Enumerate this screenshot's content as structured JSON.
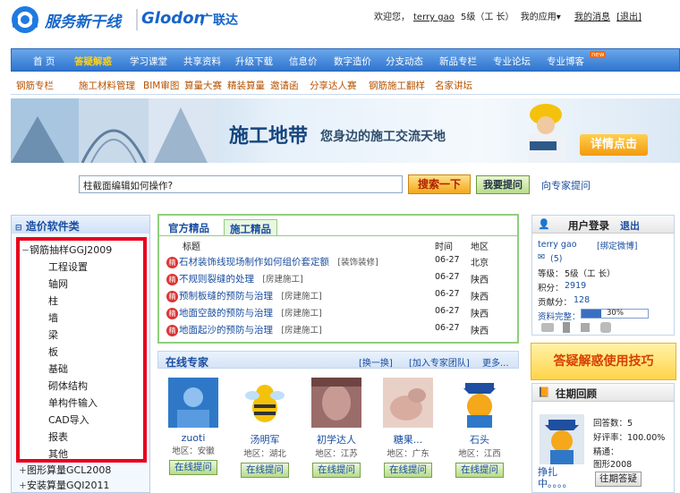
{
  "header": {
    "logo_text": "服务新干线",
    "brand": "Glodon",
    "brand_cn": "广联达",
    "welcome": "欢迎您，",
    "username": "terry gao",
    "level": "5级（工    长）",
    "my_app": "我的应用▾",
    "my_msg": "我的消息",
    "logout": "[退出]"
  },
  "nav": [
    "首 页",
    "答疑解惑",
    "学习课堂",
    "共享资料",
    "升级下载",
    "信息价",
    "数字造价",
    "分支动态",
    "新品专栏",
    "专业论坛",
    "专业博客"
  ],
  "nav_new_badge": "new",
  "subnav": [
    "钢筋专栏",
    "施工材料管理",
    "BIM审图",
    "算量大赛",
    "精装算量",
    "邀请函",
    "分享达人赛",
    "钢筋施工翻样",
    "名家讲坛"
  ],
  "banner": {
    "title": "施工地带",
    "slogan": "您身边的施工交流天地",
    "detail_btn": "详情点击"
  },
  "search": {
    "value": "柱截面编辑如何操作?",
    "search_btn": "搜索一下",
    "ask_btn": "我要提问",
    "expert_link": "向专家提问"
  },
  "tree": {
    "head": "造价软件类",
    "expanded": "钢筋抽样GGJ2009",
    "children": [
      "工程设置",
      "轴网",
      "柱",
      "墙",
      "梁",
      "板",
      "基础",
      "砌体结构",
      "单构件输入",
      "CAD导入",
      "报表",
      "其他"
    ],
    "collapsed": [
      "图形算量GCL2008",
      "安装算量GQI2011"
    ]
  },
  "notice": {
    "tabs": [
      "官方精品",
      "施工精品"
    ],
    "cols": [
      "标题",
      "时间",
      "地区"
    ],
    "rows": [
      {
        "title": "石材装饰线现场制作如何组价套定额",
        "tag": "[装饰装修]",
        "date": "06-27",
        "region": "北京"
      },
      {
        "title": "不规则裂缝的处理",
        "tag": "[房建施工]",
        "date": "06-27",
        "region": "陕西"
      },
      {
        "title": "预制板缝的预防与治理",
        "tag": "[房建施工]",
        "date": "06-27",
        "region": "陕西"
      },
      {
        "title": "地面空鼓的预防与治理",
        "tag": "[房建施工]",
        "date": "06-27",
        "region": "陕西"
      },
      {
        "title": "地面起沙的预防与治理",
        "tag": "[房建施工]",
        "date": "06-27",
        "region": "陕西"
      }
    ],
    "hot": "精"
  },
  "experts": {
    "title": "在线专家",
    "change": "[换一换]",
    "join": "[加入专家团队]",
    "more": "更多...",
    "list": [
      {
        "name": "zuoti",
        "loc": "地区：安徽"
      },
      {
        "name": "汤明军",
        "loc": "地区：湖北"
      },
      {
        "name": "初学达人",
        "loc": "地区：江苏"
      },
      {
        "name": "糖果...",
        "loc": "地区：广东"
      },
      {
        "name": "石头",
        "loc": "地区：江西"
      }
    ],
    "btn": "在线提问"
  },
  "login": {
    "title": "用户登录",
    "logout": "退出",
    "user": "terry gao",
    "bind": "[绑定微博]",
    "mail": "(5)",
    "level_label": "等级：",
    "level": "5级（工    长）",
    "score_label": "积分：",
    "score": "2919",
    "contrib_label": "贡献分：",
    "contrib": "128",
    "complete_label": "资料完整：",
    "complete": "30%",
    "complete_value": 0.3
  },
  "tips": "答疑解惑使用技巧",
  "review": {
    "title": "往期回顾",
    "answers": "回答数：5",
    "rate": "好评率：100.00%",
    "best": "精通：",
    "best_val": "图形2008",
    "name": "挣扎中。。。。",
    "btn": "往期答疑"
  },
  "colors": {
    "nav": "#2f74cf",
    "highlight": "#e8001c",
    "orange": "#f3a81a",
    "green": "#8fcf7c"
  }
}
